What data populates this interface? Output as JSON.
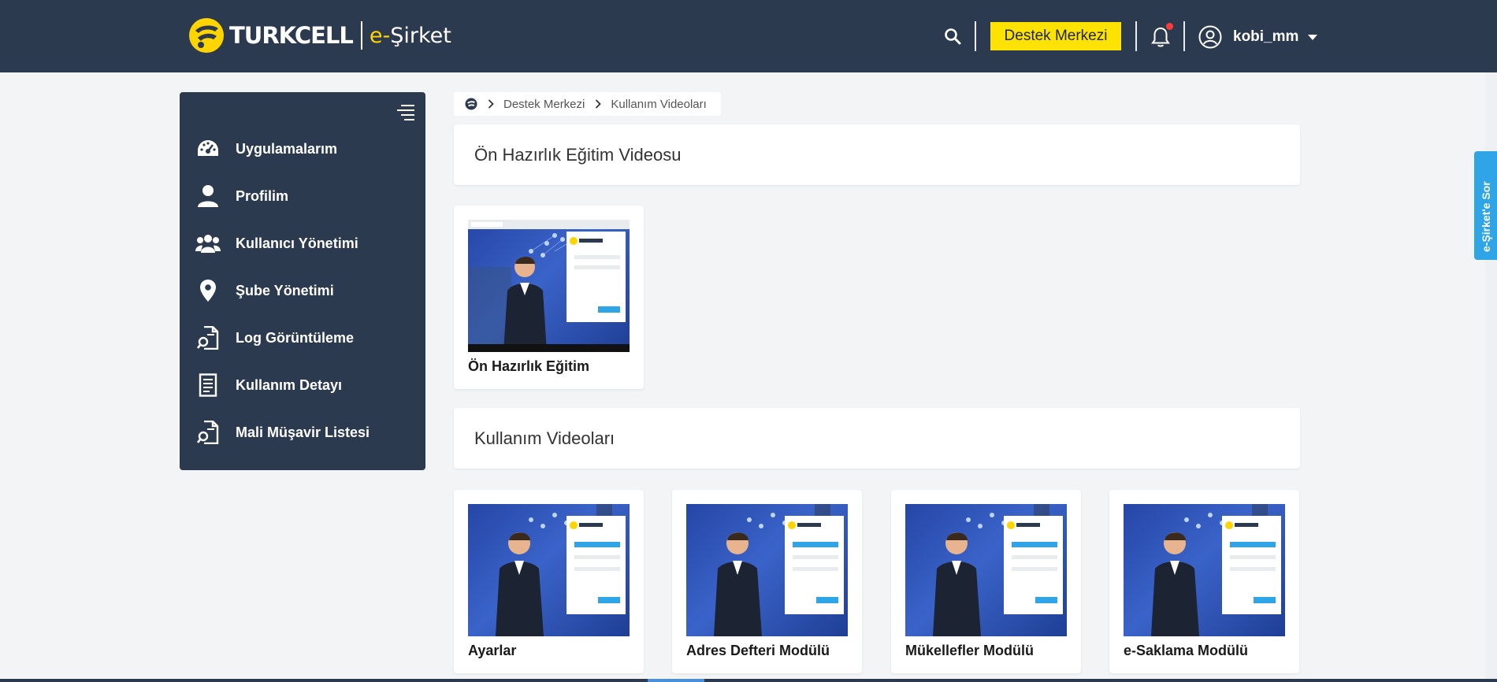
{
  "header": {
    "logo_brand": "TURKCELL",
    "logo_product_prefix": "e-",
    "logo_product": "Şirket",
    "support_label": "Destek Merkezi",
    "username": "kobi_mm"
  },
  "sidebar": {
    "items": [
      {
        "label": "Uygulamalarım",
        "icon": "dashboard-icon"
      },
      {
        "label": "Profilim",
        "icon": "user-icon"
      },
      {
        "label": "Kullanıcı Yönetimi",
        "icon": "users-icon"
      },
      {
        "label": "Şube Yönetimi",
        "icon": "location-pin-icon"
      },
      {
        "label": "Log Görüntüleme",
        "icon": "log-document-icon"
      },
      {
        "label": "Kullanım Detayı",
        "icon": "document-list-icon"
      },
      {
        "label": "Mali Müşavir Listesi",
        "icon": "log-document-icon"
      }
    ]
  },
  "breadcrumb": {
    "items": [
      "Destek Merkezi",
      "Kullanım Videoları"
    ]
  },
  "sections": [
    {
      "title": "Ön Hazırlık Eğitim Videosu",
      "videos": [
        {
          "title": "Ön Hazırlık Eğitim"
        }
      ]
    },
    {
      "title": "Kullanım Videoları",
      "videos": [
        {
          "title": "Ayarlar"
        },
        {
          "title": "Adres Defteri Modülü"
        },
        {
          "title": "Mükellefler Modülü"
        },
        {
          "title": "e-Saklama Modülü"
        }
      ]
    }
  ],
  "side_tab": {
    "label": "e-Şirket'e Sor"
  },
  "colors": {
    "header_bg": "#2c3a4f",
    "accent_yellow": "#ffe300",
    "side_tab_blue": "#2fa5e8",
    "page_bg": "#f3f4f6"
  }
}
